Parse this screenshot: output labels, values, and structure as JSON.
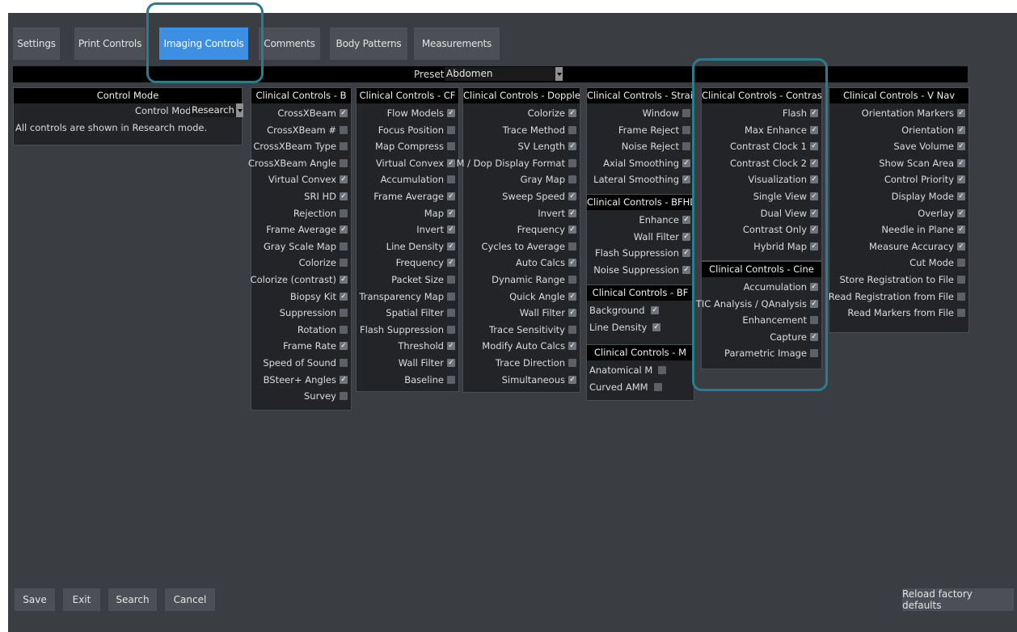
{
  "tabs": [
    "Settings",
    "Print Controls",
    "Imaging Controls",
    "Comments",
    "Body Patterns",
    "Measurements"
  ],
  "preset": {
    "label": "Preset",
    "value": "Abdomen"
  },
  "control_mode": {
    "title": "Control Mode",
    "label": "Control Mode",
    "value": "Research",
    "note": "All controls are shown in Research mode."
  },
  "panels": [
    {
      "title": "Clinical Controls - B",
      "items": [
        {
          "label": "CrossXBeam",
          "checked": true
        },
        {
          "label": "CrossXBeam #",
          "checked": false
        },
        {
          "label": "CrossXBeam Type",
          "checked": false
        },
        {
          "label": "CrossXBeam Angle",
          "checked": false
        },
        {
          "label": "Virtual Convex",
          "checked": true
        },
        {
          "label": "SRI HD",
          "checked": true
        },
        {
          "label": "Rejection",
          "checked": false
        },
        {
          "label": "Frame Average",
          "checked": true
        },
        {
          "label": "Gray Scale Map",
          "checked": false
        },
        {
          "label": "Colorize",
          "checked": false
        },
        {
          "label": "Colorize (contrast)",
          "checked": true
        },
        {
          "label": "Biopsy Kit",
          "checked": true
        },
        {
          "label": "Suppression",
          "checked": false
        },
        {
          "label": "Rotation",
          "checked": false
        },
        {
          "label": "Frame Rate",
          "checked": true
        },
        {
          "label": "Speed of Sound",
          "checked": false
        },
        {
          "label": "BSteer+ Angles",
          "checked": true
        },
        {
          "label": "Survey",
          "checked": false
        }
      ]
    },
    {
      "title": "Clinical Controls - CF",
      "items": [
        {
          "label": "Flow Models",
          "checked": true
        },
        {
          "label": "Focus Position",
          "checked": false
        },
        {
          "label": "Map Compress",
          "checked": false
        },
        {
          "label": "Virtual Convex",
          "checked": true
        },
        {
          "label": "Accumulation",
          "checked": false
        },
        {
          "label": "Frame Average",
          "checked": true
        },
        {
          "label": "Map",
          "checked": true
        },
        {
          "label": "Invert",
          "checked": true
        },
        {
          "label": "Line Density",
          "checked": true
        },
        {
          "label": "Frequency",
          "checked": true
        },
        {
          "label": "Packet Size",
          "checked": false
        },
        {
          "label": "Transparency Map",
          "checked": false
        },
        {
          "label": "Spatial Filter",
          "checked": false
        },
        {
          "label": "Flash Suppression",
          "checked": false
        },
        {
          "label": "Threshold",
          "checked": true
        },
        {
          "label": "Wall Filter",
          "checked": true
        },
        {
          "label": "Baseline",
          "checked": false
        }
      ]
    },
    {
      "title": "Clinical Controls - Doppler",
      "items": [
        {
          "label": "Colorize",
          "checked": true
        },
        {
          "label": "Trace Method",
          "checked": false
        },
        {
          "label": "SV Length",
          "checked": true
        },
        {
          "label": "M / Dop Display Format",
          "checked": false
        },
        {
          "label": "Gray Map",
          "checked": false
        },
        {
          "label": "Sweep Speed",
          "checked": true
        },
        {
          "label": "Invert",
          "checked": true
        },
        {
          "label": "Frequency",
          "checked": true
        },
        {
          "label": "Cycles to Average",
          "checked": false
        },
        {
          "label": "Auto Calcs",
          "checked": true
        },
        {
          "label": "Dynamic Range",
          "checked": false
        },
        {
          "label": "Quick Angle",
          "checked": true
        },
        {
          "label": "Wall Filter",
          "checked": true
        },
        {
          "label": "Trace Sensitivity",
          "checked": false
        },
        {
          "label": "Modify Auto Calcs",
          "checked": true
        },
        {
          "label": "Trace Direction",
          "checked": false
        },
        {
          "label": "Simultaneous",
          "checked": true
        }
      ]
    },
    {
      "title": "Clinical Controls - Strain",
      "items": [
        {
          "label": "Window",
          "checked": false
        },
        {
          "label": "Frame Reject",
          "checked": false
        },
        {
          "label": "Noise Reject",
          "checked": false
        },
        {
          "label": "Axial Smoothing",
          "checked": true
        },
        {
          "label": "Lateral Smoothing",
          "checked": true
        }
      ]
    },
    {
      "title": "Clinical Controls - BFHDC",
      "items": [
        {
          "label": "Enhance",
          "checked": true
        },
        {
          "label": "Wall Filter",
          "checked": true
        },
        {
          "label": "Flash Suppression",
          "checked": true
        },
        {
          "label": "Noise Suppression",
          "checked": true
        }
      ]
    },
    {
      "title": "Clinical Controls - BF",
      "items": [
        {
          "label": "Background",
          "checked": true
        },
        {
          "label": "Line Density",
          "checked": true
        }
      ]
    },
    {
      "title": "Clinical Controls - M",
      "items": [
        {
          "label": "Anatomical M",
          "checked": false
        },
        {
          "label": "Curved AMM",
          "checked": false
        }
      ]
    },
    {
      "title": "Clinical Controls - Contrast",
      "items": [
        {
          "label": "Flash",
          "checked": true
        },
        {
          "label": "Max Enhance",
          "checked": true
        },
        {
          "label": "Contrast Clock 1",
          "checked": true
        },
        {
          "label": "Contrast Clock 2",
          "checked": true
        },
        {
          "label": "Visualization",
          "checked": true
        },
        {
          "label": "Single View",
          "checked": true
        },
        {
          "label": "Dual View",
          "checked": true
        },
        {
          "label": "Contrast Only",
          "checked": true
        },
        {
          "label": "Hybrid Map",
          "checked": true
        }
      ]
    },
    {
      "title": "Clinical Controls - Cine",
      "items": [
        {
          "label": "Accumulation",
          "checked": true
        },
        {
          "label": "TIC Analysis / QAnalysis",
          "checked": true
        },
        {
          "label": "Enhancement",
          "checked": false
        },
        {
          "label": "Capture",
          "checked": true
        },
        {
          "label": "Parametric Image",
          "checked": false
        }
      ]
    },
    {
      "title": "Clinical Controls - V Nav",
      "items": [
        {
          "label": "Orientation Markers",
          "checked": true
        },
        {
          "label": "Orientation",
          "checked": true
        },
        {
          "label": "Save Volume",
          "checked": true
        },
        {
          "label": "Show Scan Area",
          "checked": true
        },
        {
          "label": "Control Priority",
          "checked": true
        },
        {
          "label": "Display Mode",
          "checked": true
        },
        {
          "label": "Overlay",
          "checked": true
        },
        {
          "label": "Needle in Plane",
          "checked": true
        },
        {
          "label": "Measure Accuracy",
          "checked": true
        },
        {
          "label": "Cut Mode",
          "checked": false
        },
        {
          "label": "Store Registration to File",
          "checked": false
        },
        {
          "label": "Read Registration from File",
          "checked": false
        },
        {
          "label": "Read Markers from File",
          "checked": false
        }
      ]
    }
  ],
  "buttons": {
    "save": "Save",
    "exit": "Exit",
    "search": "Search",
    "cancel": "Cancel",
    "reload": "Reload factory defaults"
  },
  "colors": {
    "background": "#3a3d41",
    "active_tab": "#3d8fe3",
    "highlight": "#2b7c8c",
    "panel_header": "#000000"
  }
}
